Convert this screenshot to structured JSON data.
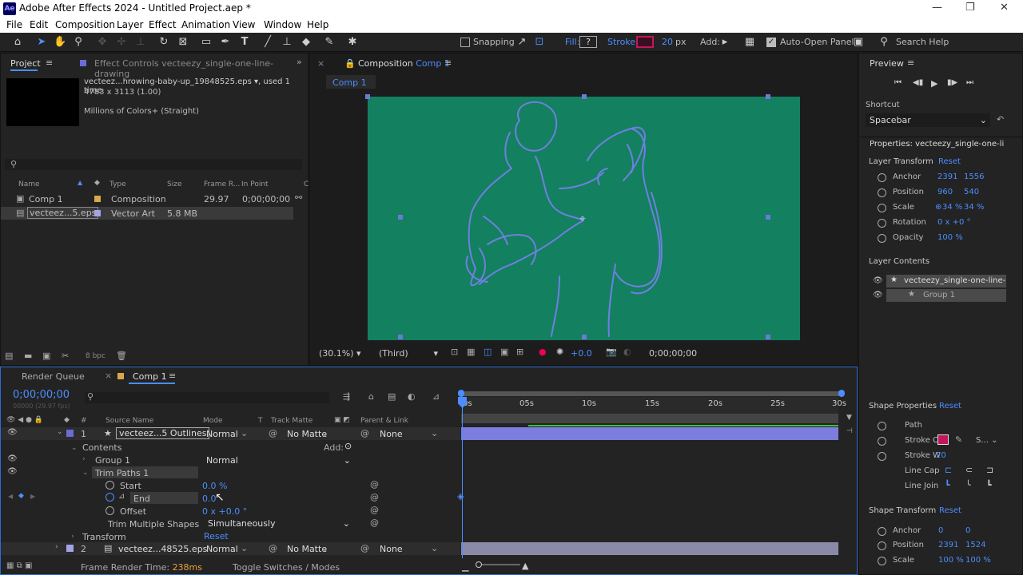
{
  "app": {
    "title": "Adobe After Effects 2024 - Untitled Project.aep *",
    "logo": "Ae"
  },
  "menu": [
    "File",
    "Edit",
    "Composition",
    "Layer",
    "Effect",
    "Animation",
    "View",
    "Window",
    "Help"
  ],
  "toolbar": {
    "snapping": "Snapping",
    "fill": "Fill:",
    "fill_value": "?",
    "stroke": "Stroke:",
    "stroke_px": "20",
    "stroke_unit": "px",
    "add": "Add:",
    "auto_open": "Auto-Open Panel",
    "search": "Search Help",
    "stroke_color": "#c2185b"
  },
  "project": {
    "tab": "Project",
    "effect_tab": "Effect Controls vecteezy_single-one-line-drawing",
    "file_name": "vecteez...hrowing-baby-up_19848525.eps",
    "used": ", used 1 time",
    "dims": "4783 x 3113 (1.00)",
    "colors": "Millions of Colors+ (Straight)",
    "cols": {
      "name": "Name",
      "type": "Type",
      "size": "Size",
      "frame": "Frame R...",
      "in": "In Point",
      "extra": "C"
    },
    "items": [
      {
        "name": "Comp 1",
        "type": "Composition",
        "size": "",
        "frame": "29.97",
        "in": "0;00;00;00"
      },
      {
        "name": "vecteez...5.eps",
        "type": "Vector Art",
        "size": "5.8 MB",
        "frame": "",
        "in": ""
      }
    ],
    "bpc": "8 bpc"
  },
  "comp": {
    "tab": "Composition",
    "tab_name": "Comp 1",
    "crumb": "Comp 1",
    "zoom": "(30.1%)",
    "res": "(Third)",
    "exposure": "+0.0",
    "time": "0;00;00;00",
    "bg": "#138060"
  },
  "timeline": {
    "render_queue": "Render Queue",
    "comp_tab": "Comp 1",
    "timecode": "0;00;00;00",
    "fps": "00000 (29.97 fps)",
    "cols": {
      "num": "#",
      "source": "Source Name",
      "mode": "Mode",
      "t": "T",
      "matte": "Track Matte",
      "parent": "Parent & Link"
    },
    "ruler": [
      "0s",
      "05s",
      "10s",
      "15s",
      "20s",
      "25s",
      "30s"
    ],
    "layer1": {
      "num": "1",
      "name": "vecteez...5 Outlines",
      "mode": "Normal",
      "matte": "No Matte",
      "parent": "None"
    },
    "contents": "Contents",
    "add": "Add:",
    "group1": "Group 1",
    "group1_mode": "Normal",
    "trim": "Trim Paths 1",
    "start": "Start",
    "start_val": "0.0 %",
    "end": "End",
    "end_val": "0.0",
    "offset": "Offset",
    "offset_val": "0 x +0.0 °",
    "trim_multi": "Trim Multiple Shapes",
    "trim_multi_val": "Simultaneously",
    "transform": "Transform",
    "reset": "Reset",
    "layer2": {
      "num": "2",
      "name": "vecteez...48525.eps",
      "mode": "Normal",
      "matte": "No Matte",
      "parent": "None"
    },
    "render_time_label": "Frame Render Time:",
    "render_time": "238ms",
    "toggle": "Toggle Switches / Modes"
  },
  "preview": {
    "title": "Preview",
    "shortcut_label": "Shortcut",
    "shortcut": "Spacebar"
  },
  "properties": {
    "title": "Properties: vecteezy_single-one-li",
    "layer_transform": "Layer Transform",
    "reset": "Reset",
    "anchor": "Anchor",
    "anchor_x": "2391",
    "anchor_y": "1556",
    "position": "Position",
    "pos_x": "960",
    "pos_y": "540",
    "scale": "Scale",
    "scale_x": "34 %",
    "scale_y": "34 %",
    "rotation": "Rotation",
    "rotation_val": "0 x +0 °",
    "opacity": "Opacity",
    "opacity_val": "100 %",
    "layer_contents": "Layer Contents",
    "lc_item1": "vecteezy_single-one-line-",
    "lc_item2": "Group 1",
    "shape_props": "Shape Properties",
    "path": "Path",
    "stroke_c": "Stroke C",
    "stroke_w": "Stroke W",
    "stroke_w_val": "20",
    "line_cap": "Line Cap",
    "line_join": "Line Join",
    "shape_transform": "Shape Transform",
    "st_anchor_x": "0",
    "st_anchor_y": "0",
    "st_pos_x": "2391",
    "st_pos_y": "1524",
    "st_scale_x": "100 %",
    "st_scale_y": "100 %"
  }
}
